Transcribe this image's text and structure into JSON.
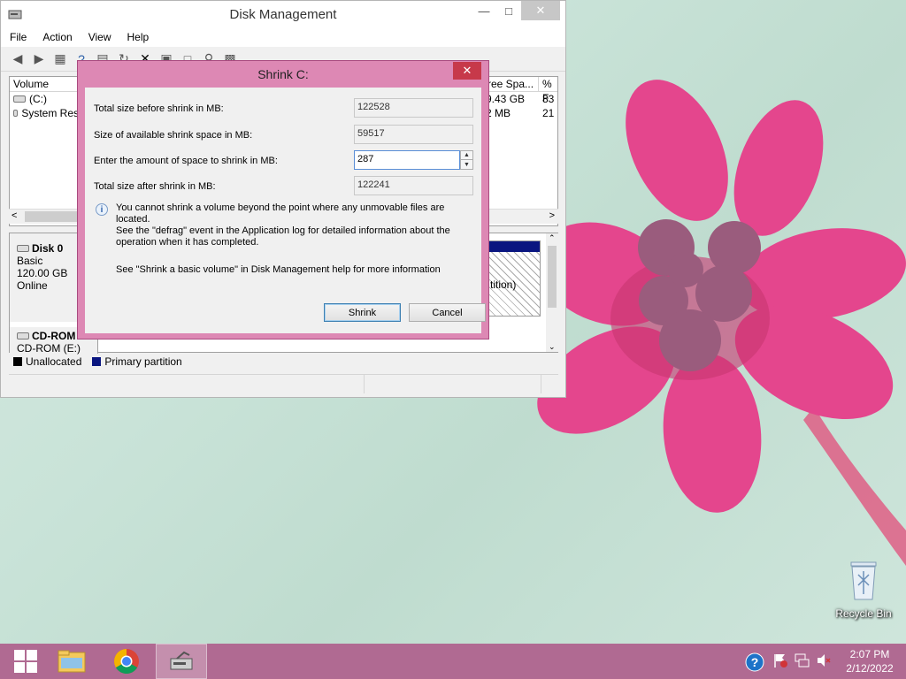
{
  "disk_management": {
    "title": "Disk Management",
    "menu": [
      "File",
      "Action",
      "View",
      "Help"
    ],
    "volume_list": {
      "columns": [
        "Volume",
        "ree Spa...",
        "% F"
      ],
      "rows": [
        {
          "name": "(C:)",
          "free": "9.43 GB",
          "pct": "83"
        },
        {
          "name": "System Res",
          "free": "2 MB",
          "pct": "21"
        }
      ]
    },
    "disks": [
      {
        "name": "Disk 0",
        "type": "Basic",
        "size": "120.00 GB",
        "status": "Online"
      },
      {
        "name": "CD-ROM",
        "label": "CD-ROM (E:)"
      }
    ],
    "partition_text": "tition)",
    "legend": [
      {
        "label": "Unallocated",
        "color": "#000000"
      },
      {
        "label": "Primary partition",
        "color": "#0a1680"
      }
    ]
  },
  "dialog": {
    "title": "Shrink C:",
    "fields": [
      {
        "label": "Total size before shrink in MB:",
        "value": "122528"
      },
      {
        "label": "Size of available shrink space in MB:",
        "value": "59517"
      },
      {
        "label": "Enter the amount of space to shrink in MB:",
        "value": "287"
      },
      {
        "label": "Total size after shrink in MB:",
        "value": "122241"
      }
    ],
    "info_lines": [
      "You cannot shrink a volume beyond the point where any unmovable files are located.",
      "See the \"defrag\" event in the Application log for detailed information about the",
      "operation when it has completed."
    ],
    "help": "See \"Shrink a basic volume\" in Disk Management help for more information",
    "buttons": {
      "shrink": "Shrink",
      "cancel": "Cancel"
    }
  },
  "desktop": {
    "recycle_bin": "Recycle Bin"
  },
  "taskbar": {
    "clock_time": "2:07 PM",
    "clock_date": "2/12/2022"
  },
  "colors": {
    "dialog_frame": "#dd88b4",
    "taskbar": "#b06a92",
    "primary_partition": "#0a1680"
  }
}
